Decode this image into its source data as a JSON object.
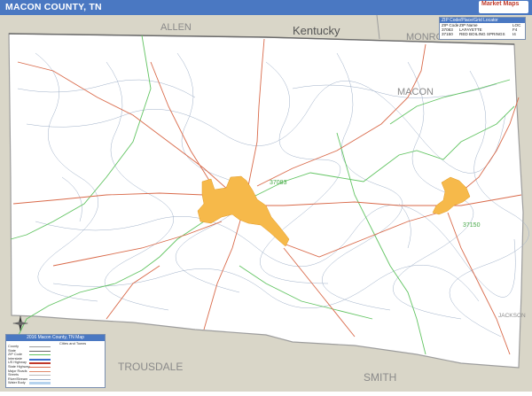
{
  "header": {
    "title": "MACON COUNTY, TN",
    "logo_text": "Market Maps"
  },
  "map": {
    "labels": {
      "kentucky": "Kentucky",
      "allen": "ALLEN",
      "monroe": "MONROE",
      "macon": "MACON",
      "trousdale": "TROUSDALE",
      "smith": "SMITH",
      "jackson": "JACKSON",
      "zip_37083": "37083",
      "zip_37150": "37150"
    },
    "colors": {
      "header": "#4a78c2",
      "neighbor": "#d9d6c8",
      "county": "#ffffff",
      "city": "#f6b94a",
      "road": "#d96a4a",
      "zip_boundary": "#62c462",
      "stream": "#9fb0c8"
    }
  },
  "zip_locator": {
    "title": "ZIP Code/Place/Grid Locator",
    "headers": [
      "ZIP Code",
      "ZIP Name",
      "LOC"
    ],
    "rows": [
      [
        "37083",
        "LAFAYETTE",
        "F4"
      ],
      [
        "37150",
        "RED BOILING SPRINGS",
        "I4"
      ]
    ]
  },
  "legend": {
    "title": "2016 Macon County, TN Map",
    "subtitle": "Cities and Towns",
    "items": [
      "County",
      "State",
      "ZIP Code",
      "Interstate",
      "US Highway",
      "State Highway",
      "Major Roads",
      "Streets",
      "River/Stream",
      "Water Body"
    ],
    "compass": "N"
  }
}
